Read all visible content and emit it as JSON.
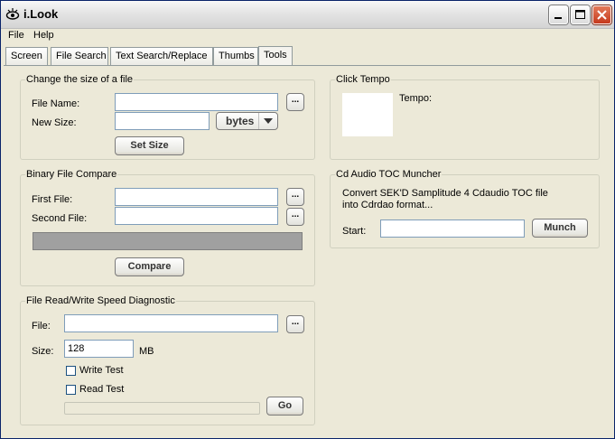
{
  "window": {
    "title": "i.Look"
  },
  "menu": [
    {
      "label": "File"
    },
    {
      "label": "Help"
    }
  ],
  "tabs": [
    {
      "label": "Screen"
    },
    {
      "label": "File Search"
    },
    {
      "label": "Text Search/Replace"
    },
    {
      "label": "Thumbs"
    },
    {
      "label": "Tools"
    }
  ],
  "resize_group": {
    "title": "Change the size of a file",
    "file_name_label": "File Name:",
    "file_name_value": "",
    "new_size_label": "New Size:",
    "new_size_value": "",
    "unit_selected": "bytes",
    "browse_label": "...",
    "set_size_label": "Set Size"
  },
  "compare_group": {
    "title": "Binary File Compare",
    "first_file_label": "First File:",
    "second_file_label": "Second File:",
    "first_file_value": "",
    "second_file_value": "",
    "browse_label": "...",
    "compare_label": "Compare"
  },
  "speed_group": {
    "title": "File Read/Write Speed Diagnostic",
    "file_label": "File:",
    "file_value": "",
    "size_label": "Size:",
    "size_value": "128",
    "size_unit": "MB",
    "write_test_label": "Write Test",
    "read_test_label": "Read Test",
    "write_test_checked": false,
    "read_test_checked": false,
    "browse_label": "...",
    "go_label": "Go",
    "progress": 0
  },
  "tempo_group": {
    "title": "Click Tempo",
    "tempo_label": "Tempo:"
  },
  "toc_group": {
    "title": "Cd Audio TOC Muncher",
    "description_line1": "Convert SEK'D Samplitude 4 Cdaudio TOC file",
    "description_line2": "into Cdrdao format...",
    "start_label": "Start:",
    "start_value": "",
    "munch_label": "Munch"
  }
}
